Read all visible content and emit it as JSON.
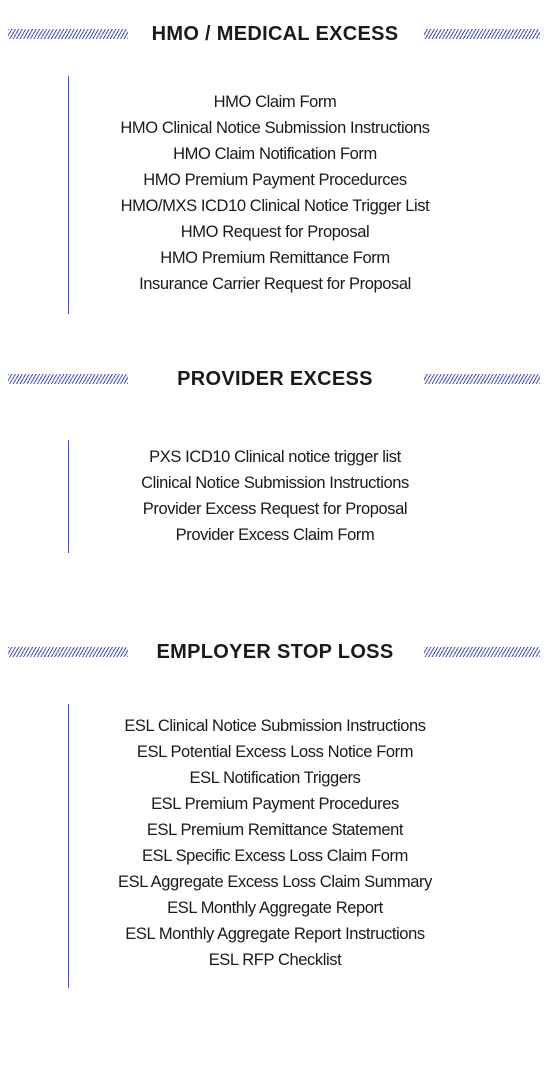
{
  "sections": [
    {
      "title": "HMO / MEDICAL EXCESS",
      "links": [
        "HMO Claim Form",
        "HMO Clinical Notice Submission Instructions",
        "HMO Claim Notification Form",
        "HMO Premium Payment Procedurces",
        "HMO/MXS ICD10 Clinical Notice Trigger List",
        "HMO Request for Proposal",
        "HMO Premium Remittance Form",
        "Insurance Carrier Request for Proposal"
      ]
    },
    {
      "title": "PROVIDER EXCESS",
      "links": [
        "PXS ICD10 Clinical notice trigger list",
        "Clinical Notice Submission Instructions",
        "Provider Excess Request for Proposal",
        "Provider Excess Claim Form"
      ]
    },
    {
      "title": "EMPLOYER STOP LOSS",
      "links": [
        "ESL Clinical Notice Submission Instructions",
        "ESL Potential Excess Loss Notice Form",
        "ESL Notification Triggers",
        "ESL Premium Payment Procedures",
        "ESL Premium Remittance Statement",
        "ESL Specific Excess Loss Claim Form",
        "ESL Aggregate Excess Loss Claim Summary",
        "ESL Monthly Aggregate Report",
        "ESL Monthly Aggregate Report Instructions",
        "ESL RFP Checklist"
      ]
    }
  ],
  "colors": {
    "accent": "#4a4fbf",
    "text": "#1a1a1a",
    "background": "#ffffff"
  }
}
